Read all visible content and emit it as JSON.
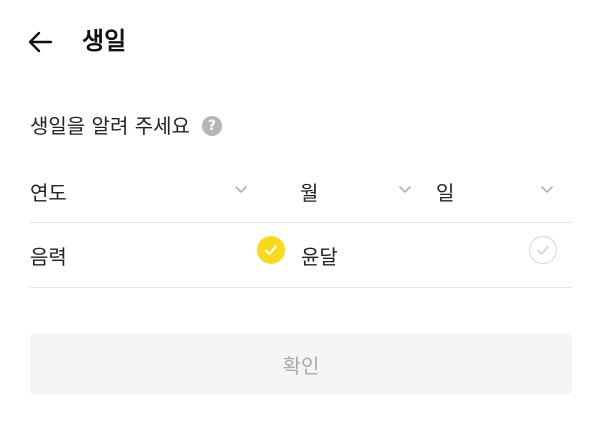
{
  "header": {
    "title": "생일",
    "back_icon": "arrow-left-icon"
  },
  "prompt": {
    "text": "생일을 알려 주세요",
    "help_icon": "question-circle-icon",
    "help_glyph": "?"
  },
  "date_selects": [
    {
      "label": "연도",
      "icon": "chevron-down-icon"
    },
    {
      "label": "월",
      "icon": "chevron-down-icon"
    },
    {
      "label": "일",
      "icon": "chevron-down-icon"
    }
  ],
  "lunar_options": [
    {
      "label": "음력",
      "checked": true
    },
    {
      "label": "윤달",
      "checked": false
    }
  ],
  "confirm_button": {
    "label": "확인",
    "enabled": false
  },
  "colors": {
    "accent_yellow": "#f9d91c",
    "disabled_bg": "#f5f5f5",
    "disabled_text": "#a9a9a9",
    "divider": "#e4e4e4"
  }
}
